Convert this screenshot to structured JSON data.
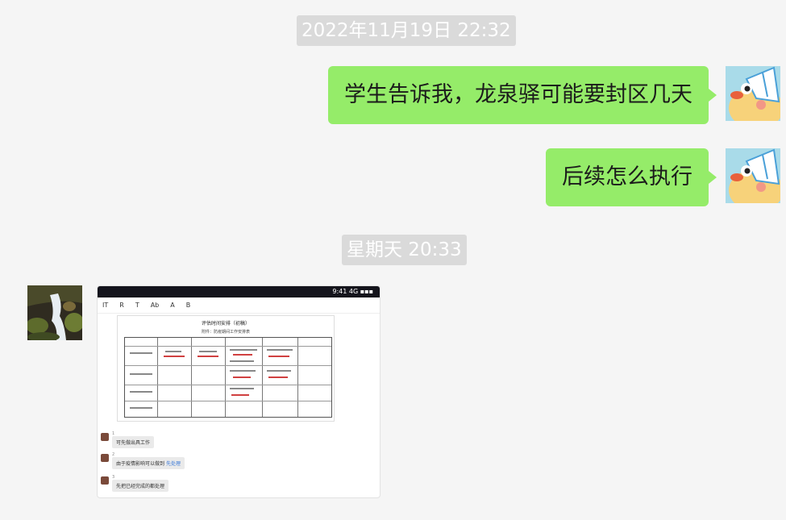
{
  "conversation": {
    "timestamps": [
      {
        "text": "2022年11月19日 22:32"
      },
      {
        "text": "星期天 20:33"
      }
    ],
    "messages_self": [
      {
        "text": "学生告诉我，龙泉驿可能要封区几天"
      },
      {
        "text": "后续怎么执行"
      }
    ],
    "incoming_image": {
      "alt": "screenshot",
      "inner": {
        "status_text": "9:41 4G ▪▪▪",
        "toolbar": [
          "IT",
          "R",
          "T",
          "Ab",
          "A",
          "B"
        ],
        "doc_title": "评估时间安排（初稿）",
        "doc_subtitle": "附件：防疫期间工作安排表",
        "chat_lines": [
          {
            "name": "1",
            "text": "可先做出具工作"
          },
          {
            "name": "2",
            "text": "由于疫情影响可以做到",
            "link": "先处理"
          },
          {
            "name": "3",
            "text": "先把已经完成的都处理"
          }
        ]
      }
    }
  },
  "colors": {
    "background": "#f5f5f5",
    "bubble_self": "#95ec69",
    "timestamp_bg": "#dadada",
    "timestamp_text": "#ffffff"
  }
}
